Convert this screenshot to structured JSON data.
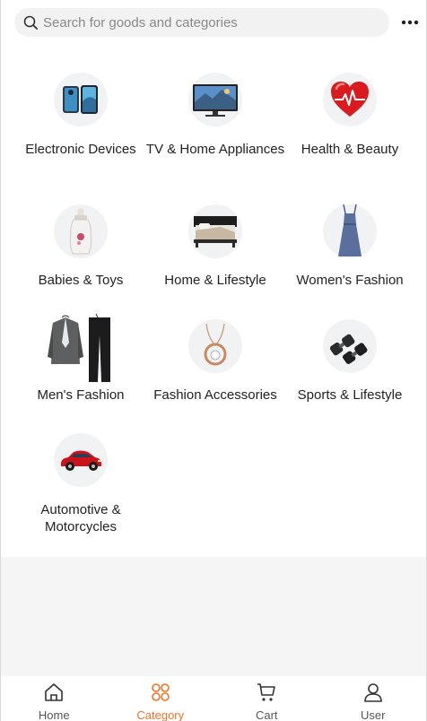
{
  "search": {
    "placeholder": "Search for goods and categories",
    "icon": "search-icon"
  },
  "header": {
    "more_icon": "more-dots-icon"
  },
  "categories": [
    {
      "label": "Electronic Devices",
      "icon": "smartphone-icon"
    },
    {
      "label": "TV & Home Appliances",
      "icon": "monitor-icon"
    },
    {
      "label": "Health & Beauty",
      "icon": "heart-icon"
    },
    {
      "label": "Babies & Toys",
      "icon": "baby-bottle-icon"
    },
    {
      "label": "Home & Lifestyle",
      "icon": "bed-icon"
    },
    {
      "label": "Women's Fashion",
      "icon": "dress-icon"
    },
    {
      "label": "Men's Fashion",
      "icon": "suit-icon"
    },
    {
      "label": "Fashion Accessories",
      "icon": "necklace-icon"
    },
    {
      "label": "Sports & Lifestyle",
      "icon": "dumbbell-icon"
    },
    {
      "label": "Automotive & Motorcycles",
      "icon": "car-icon"
    }
  ],
  "tabbar": {
    "active": "Category",
    "accent_color": "#f57224",
    "tabs": [
      {
        "label": "Home",
        "icon": "home-icon"
      },
      {
        "label": "Category",
        "icon": "category-icon"
      },
      {
        "label": "Cart",
        "icon": "cart-icon"
      },
      {
        "label": "User",
        "icon": "user-icon"
      }
    ]
  }
}
